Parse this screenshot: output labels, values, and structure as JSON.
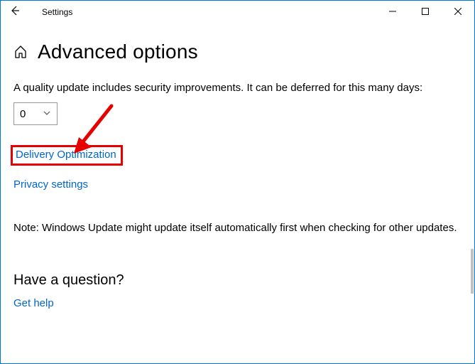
{
  "window": {
    "title": "Settings"
  },
  "header": {
    "page_title": "Advanced options"
  },
  "main": {
    "defer_description": "A quality update includes security improvements. It can be deferred for this many days:",
    "defer_value": "0",
    "link_delivery": "Delivery Optimization",
    "link_privacy": "Privacy settings",
    "note": "Note: Windows Update might update itself automatically first when checking for other updates."
  },
  "help": {
    "heading": "Have a question?",
    "link": "Get help"
  }
}
